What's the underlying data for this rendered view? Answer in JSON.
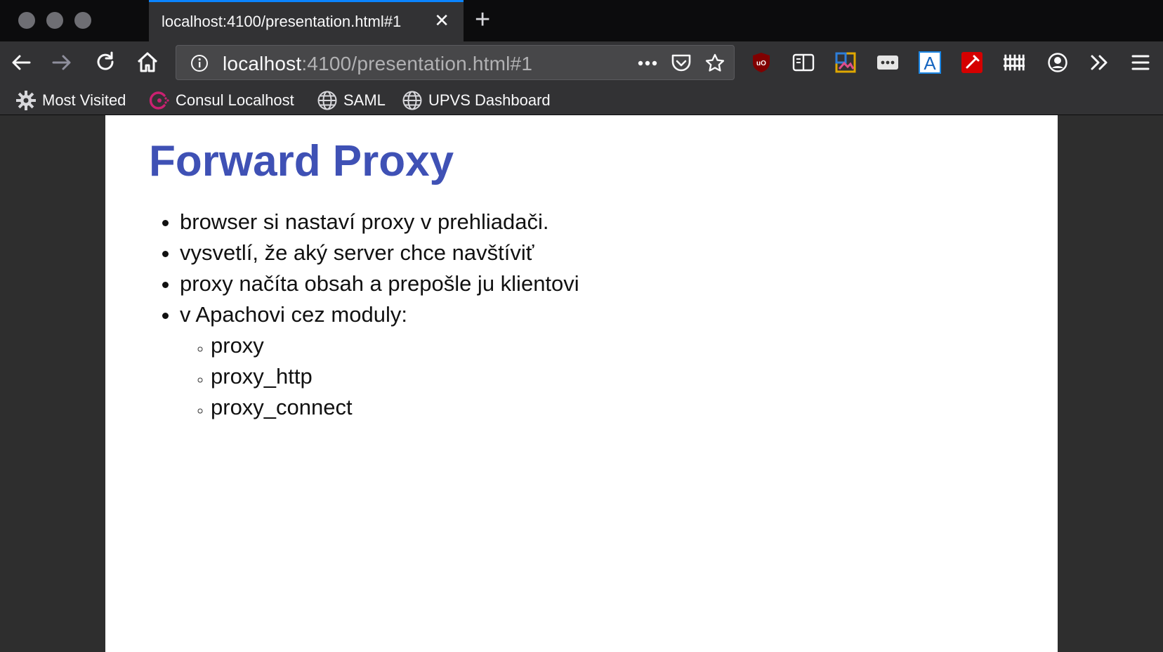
{
  "browser": {
    "tab": {
      "title": "localhost:4100/presentation.html#1"
    },
    "url": {
      "host": "localhost",
      "rest": ":4100/presentation.html#1"
    },
    "bookmarks": [
      {
        "label": "Most Visited",
        "icon": "gear-icon"
      },
      {
        "label": "Consul Localhost",
        "icon": "consul-icon"
      },
      {
        "label": "SAML",
        "icon": "globe-icon"
      },
      {
        "label": "UPVS Dashboard",
        "icon": "globe-icon"
      }
    ]
  },
  "slide": {
    "title": "Forward Proxy",
    "bullets": [
      "browser si nastaví proxy v prehliadači.",
      "vysvetlí, že aký server chce navštíviť",
      "proxy načíta obsah a prepošle ju klientovi",
      "v Apachovi cez moduly:"
    ],
    "sub_bullets": [
      "proxy",
      "proxy_http",
      "proxy_connect"
    ]
  },
  "colors": {
    "accent": "#0a84ff",
    "title": "#3f51b5",
    "tabstrip": "#0c0c0d",
    "toolbar": "#323234"
  }
}
